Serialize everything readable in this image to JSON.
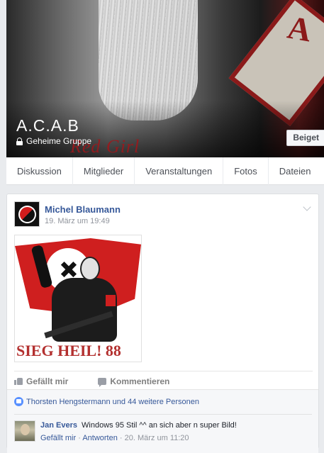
{
  "group": {
    "title": "A.C.A.B",
    "privacy": "Geheime Gruppe",
    "join_label": "Beiget"
  },
  "tabs": [
    "Diskussion",
    "Mitglieder",
    "Veranstaltungen",
    "Fotos",
    "Dateien"
  ],
  "post": {
    "author": "Michel Blaumann",
    "time": "19. März um 19:49",
    "image_caption": "SIEG HEIL! 88",
    "actions": {
      "like": "Gefällt mir",
      "comment": "Kommentieren"
    },
    "likes_summary": "Thorsten Hengstermann und 44 weitere Personen",
    "comment": {
      "author": "Jan Evers",
      "text": "Windows 95 Stil ^^ an sich aber n super Bild!",
      "like_link": "Gefällt mir",
      "reply_link": "Antworten",
      "time": "20. März um 11:20"
    }
  },
  "colors": {
    "link": "#365899",
    "page_bg": "#e9ebee",
    "like_badge": "#5890ff"
  }
}
